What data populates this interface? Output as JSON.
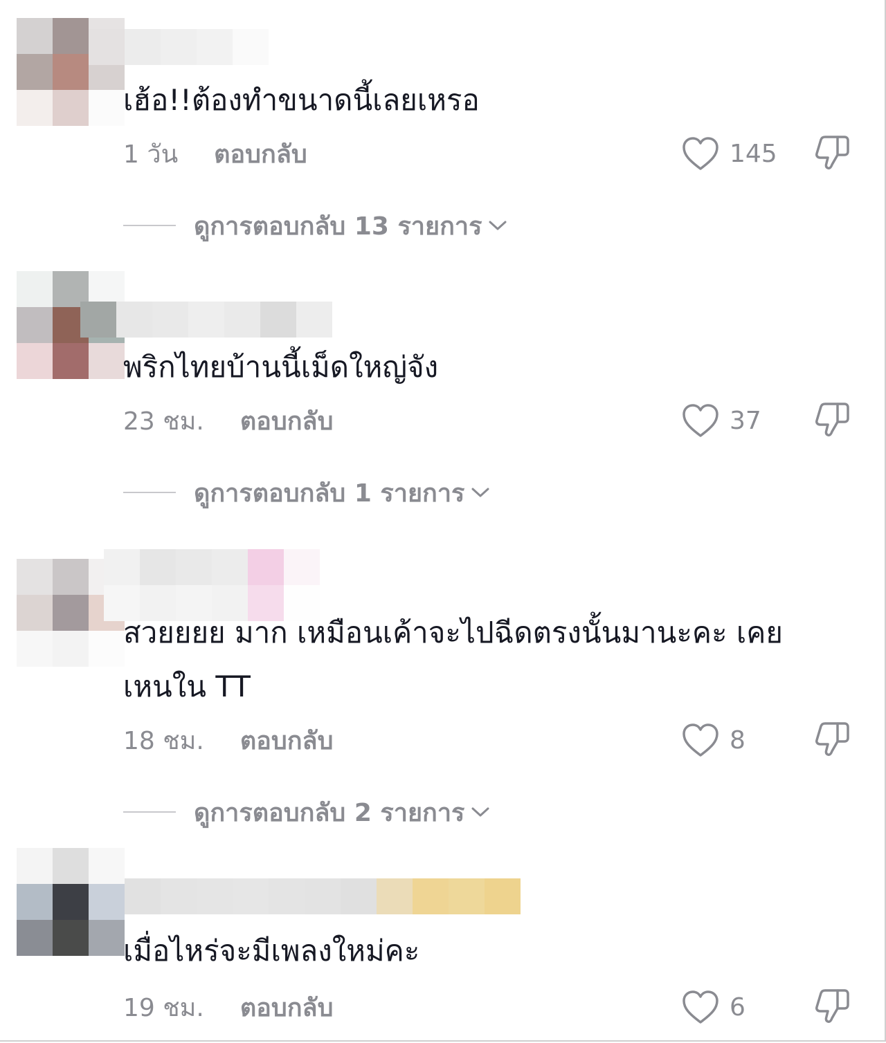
{
  "comments": [
    {
      "text": "เฮ้อ!!ต้องทำขนาดนี้เลยเหรอ",
      "time": "1 วัน",
      "reply_label": "ตอบกลับ",
      "likes": "145",
      "view_replies": "ดูการตอบกลับ 13 รายการ"
    },
    {
      "text": "พริกไทยบ้านนี้เม็ดใหญ่จัง",
      "time": "23 ชม.",
      "reply_label": "ตอบกลับ",
      "likes": "37",
      "view_replies": "ดูการตอบกลับ 1 รายการ"
    },
    {
      "text": "สวยยยย มาก เหมือนเค้าจะไปฉีดตรงนั้นมานะคะ เคย\nเหนใน TT",
      "time": "18 ชม.",
      "reply_label": "ตอบกลับ",
      "likes": "8",
      "view_replies": "ดูการตอบกลับ 2 รายการ"
    },
    {
      "text": "เมื่อไหร่จะมีเพลงใหม่คะ",
      "time": "19 ชม.",
      "reply_label": "ตอบกลับ",
      "likes": "6"
    }
  ],
  "icons": {
    "like": "heart-outline-icon",
    "dislike": "thumbs-down-outline-icon",
    "expand": "chevron-down-icon"
  },
  "colors": {
    "text": "#161823",
    "secondary": "#8a8b91",
    "divider": "#c8c8cc",
    "background": "#ffffff"
  }
}
